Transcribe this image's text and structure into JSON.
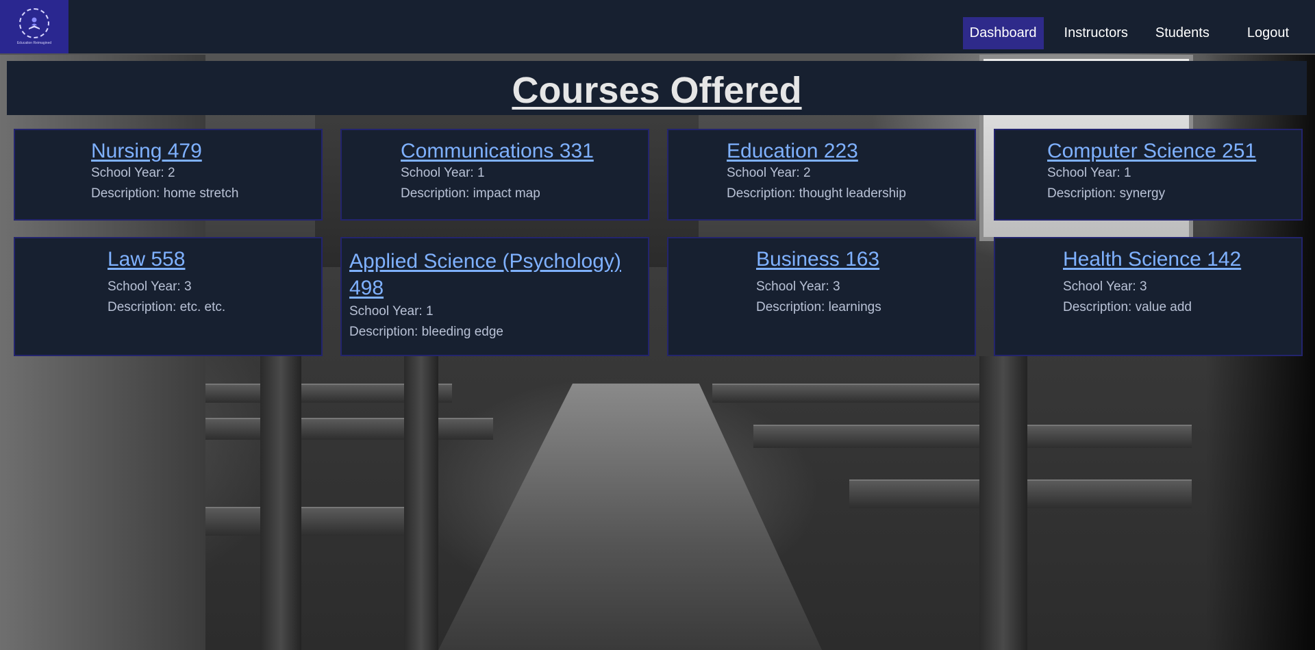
{
  "nav": {
    "logo_caption": "Education Reimagined",
    "links": [
      {
        "label": "Dashboard"
      },
      {
        "label": "Instructors"
      },
      {
        "label": "Students"
      },
      {
        "label": "Logout"
      }
    ],
    "active_color": "#2e2a8a"
  },
  "page": {
    "heading": "Courses Offered"
  },
  "courses": [
    {
      "title": "Nursing 479",
      "year": "School Year: 2",
      "description": "Description: home stretch"
    },
    {
      "title": "Communications 331",
      "year": "School Year: 1",
      "description": "Description: impact map"
    },
    {
      "title": "Education 223",
      "year": "School Year: 2",
      "description": "Description: thought leadership"
    },
    {
      "title": "Computer Science 251",
      "year": "School Year: 1",
      "description": "Description: synergy"
    },
    {
      "title": "Law 558",
      "year": "School Year: 3",
      "description": "Description: etc. etc."
    },
    {
      "title": "Applied Science (Psychology) 498",
      "year": "School Year: 1",
      "description": "Description: bleeding edge"
    },
    {
      "title": "Business 163",
      "year": "School Year: 3",
      "description": "Description: learnings"
    },
    {
      "title": "Health Science 142",
      "year": "School Year: 3",
      "description": "Description: value add"
    }
  ],
  "colors": {
    "panel": "#172030",
    "link": "#7fb1ff",
    "card_border": "#23246e",
    "logo_bg": "#2a2790"
  }
}
